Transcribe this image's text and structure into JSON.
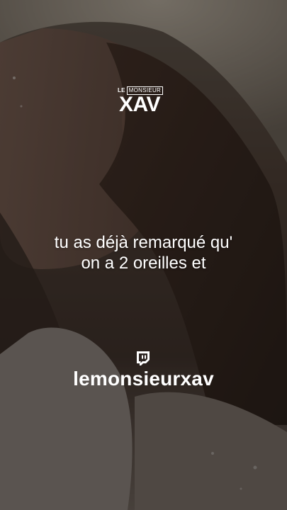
{
  "logo": {
    "le": "LE",
    "monsieur": "MONSIEUR",
    "xav": "XAV"
  },
  "caption": {
    "line1": "tu as déjà remarqué qu'",
    "line2": "on a 2 oreilles et"
  },
  "watermark": {
    "icon": "twitch-icon",
    "handle": "lemonsieurxav"
  },
  "colors": {
    "text": "#ffffff",
    "overlay": "#14100e"
  }
}
